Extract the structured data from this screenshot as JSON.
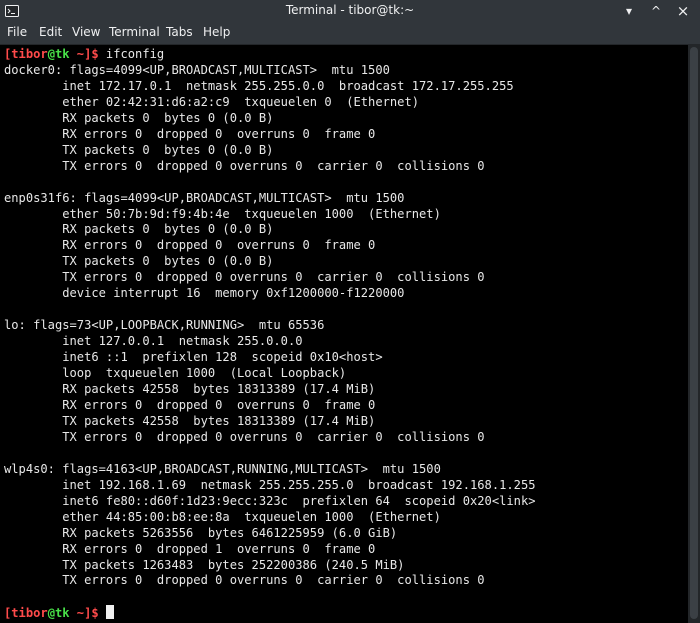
{
  "window": {
    "title": "Terminal - tibor@tk:~",
    "icon": "terminal-icon",
    "controls": {
      "minimize": "▾",
      "maximize": "^",
      "close": "×"
    }
  },
  "menubar": {
    "items": [
      "File",
      "Edit",
      "View",
      "Terminal",
      "Tabs",
      "Help"
    ]
  },
  "terminal": {
    "prompt": {
      "open_bracket": "[",
      "user": "tibor",
      "at_host": "@tk",
      "dir_and_close": " ~]$",
      "command": " ifconfig"
    },
    "output_lines": [
      "docker0: flags=4099<UP,BROADCAST,MULTICAST>  mtu 1500",
      "        inet 172.17.0.1  netmask 255.255.0.0  broadcast 172.17.255.255",
      "        ether 02:42:31:d6:a2:c9  txqueuelen 0  (Ethernet)",
      "        RX packets 0  bytes 0 (0.0 B)",
      "        RX errors 0  dropped 0  overruns 0  frame 0",
      "        TX packets 0  bytes 0 (0.0 B)",
      "        TX errors 0  dropped 0 overruns 0  carrier 0  collisions 0",
      "",
      "enp0s31f6: flags=4099<UP,BROADCAST,MULTICAST>  mtu 1500",
      "        ether 50:7b:9d:f9:4b:4e  txqueuelen 1000  (Ethernet)",
      "        RX packets 0  bytes 0 (0.0 B)",
      "        RX errors 0  dropped 0  overruns 0  frame 0",
      "        TX packets 0  bytes 0 (0.0 B)",
      "        TX errors 0  dropped 0 overruns 0  carrier 0  collisions 0",
      "        device interrupt 16  memory 0xf1200000-f1220000",
      "",
      "lo: flags=73<UP,LOOPBACK,RUNNING>  mtu 65536",
      "        inet 127.0.0.1  netmask 255.0.0.0",
      "        inet6 ::1  prefixlen 128  scopeid 0x10<host>",
      "        loop  txqueuelen 1000  (Local Loopback)",
      "        RX packets 42558  bytes 18313389 (17.4 MiB)",
      "        RX errors 0  dropped 0  overruns 0  frame 0",
      "        TX packets 42558  bytes 18313389 (17.4 MiB)",
      "        TX errors 0  dropped 0 overruns 0  carrier 0  collisions 0",
      "",
      "wlp4s0: flags=4163<UP,BROADCAST,RUNNING,MULTICAST>  mtu 1500",
      "        inet 192.168.1.69  netmask 255.255.255.0  broadcast 192.168.1.255",
      "        inet6 fe80::d60f:1d23:9ecc:323c  prefixlen 64  scopeid 0x20<link>",
      "        ether 44:85:00:b8:ee:8a  txqueuelen 1000  (Ethernet)",
      "        RX packets 5263556  bytes 6461225959 (6.0 GiB)",
      "        RX errors 0  dropped 1  overruns 0  frame 0",
      "        TX packets 1263483  bytes 252200386 (240.5 MiB)",
      "        TX errors 0  dropped 0 overruns 0  carrier 0  collisions 0",
      ""
    ],
    "final_prompt": {
      "open_bracket": "[",
      "user": "tibor",
      "at_host": "@tk",
      "dir_and_close": " ~]$",
      "command": " "
    }
  }
}
